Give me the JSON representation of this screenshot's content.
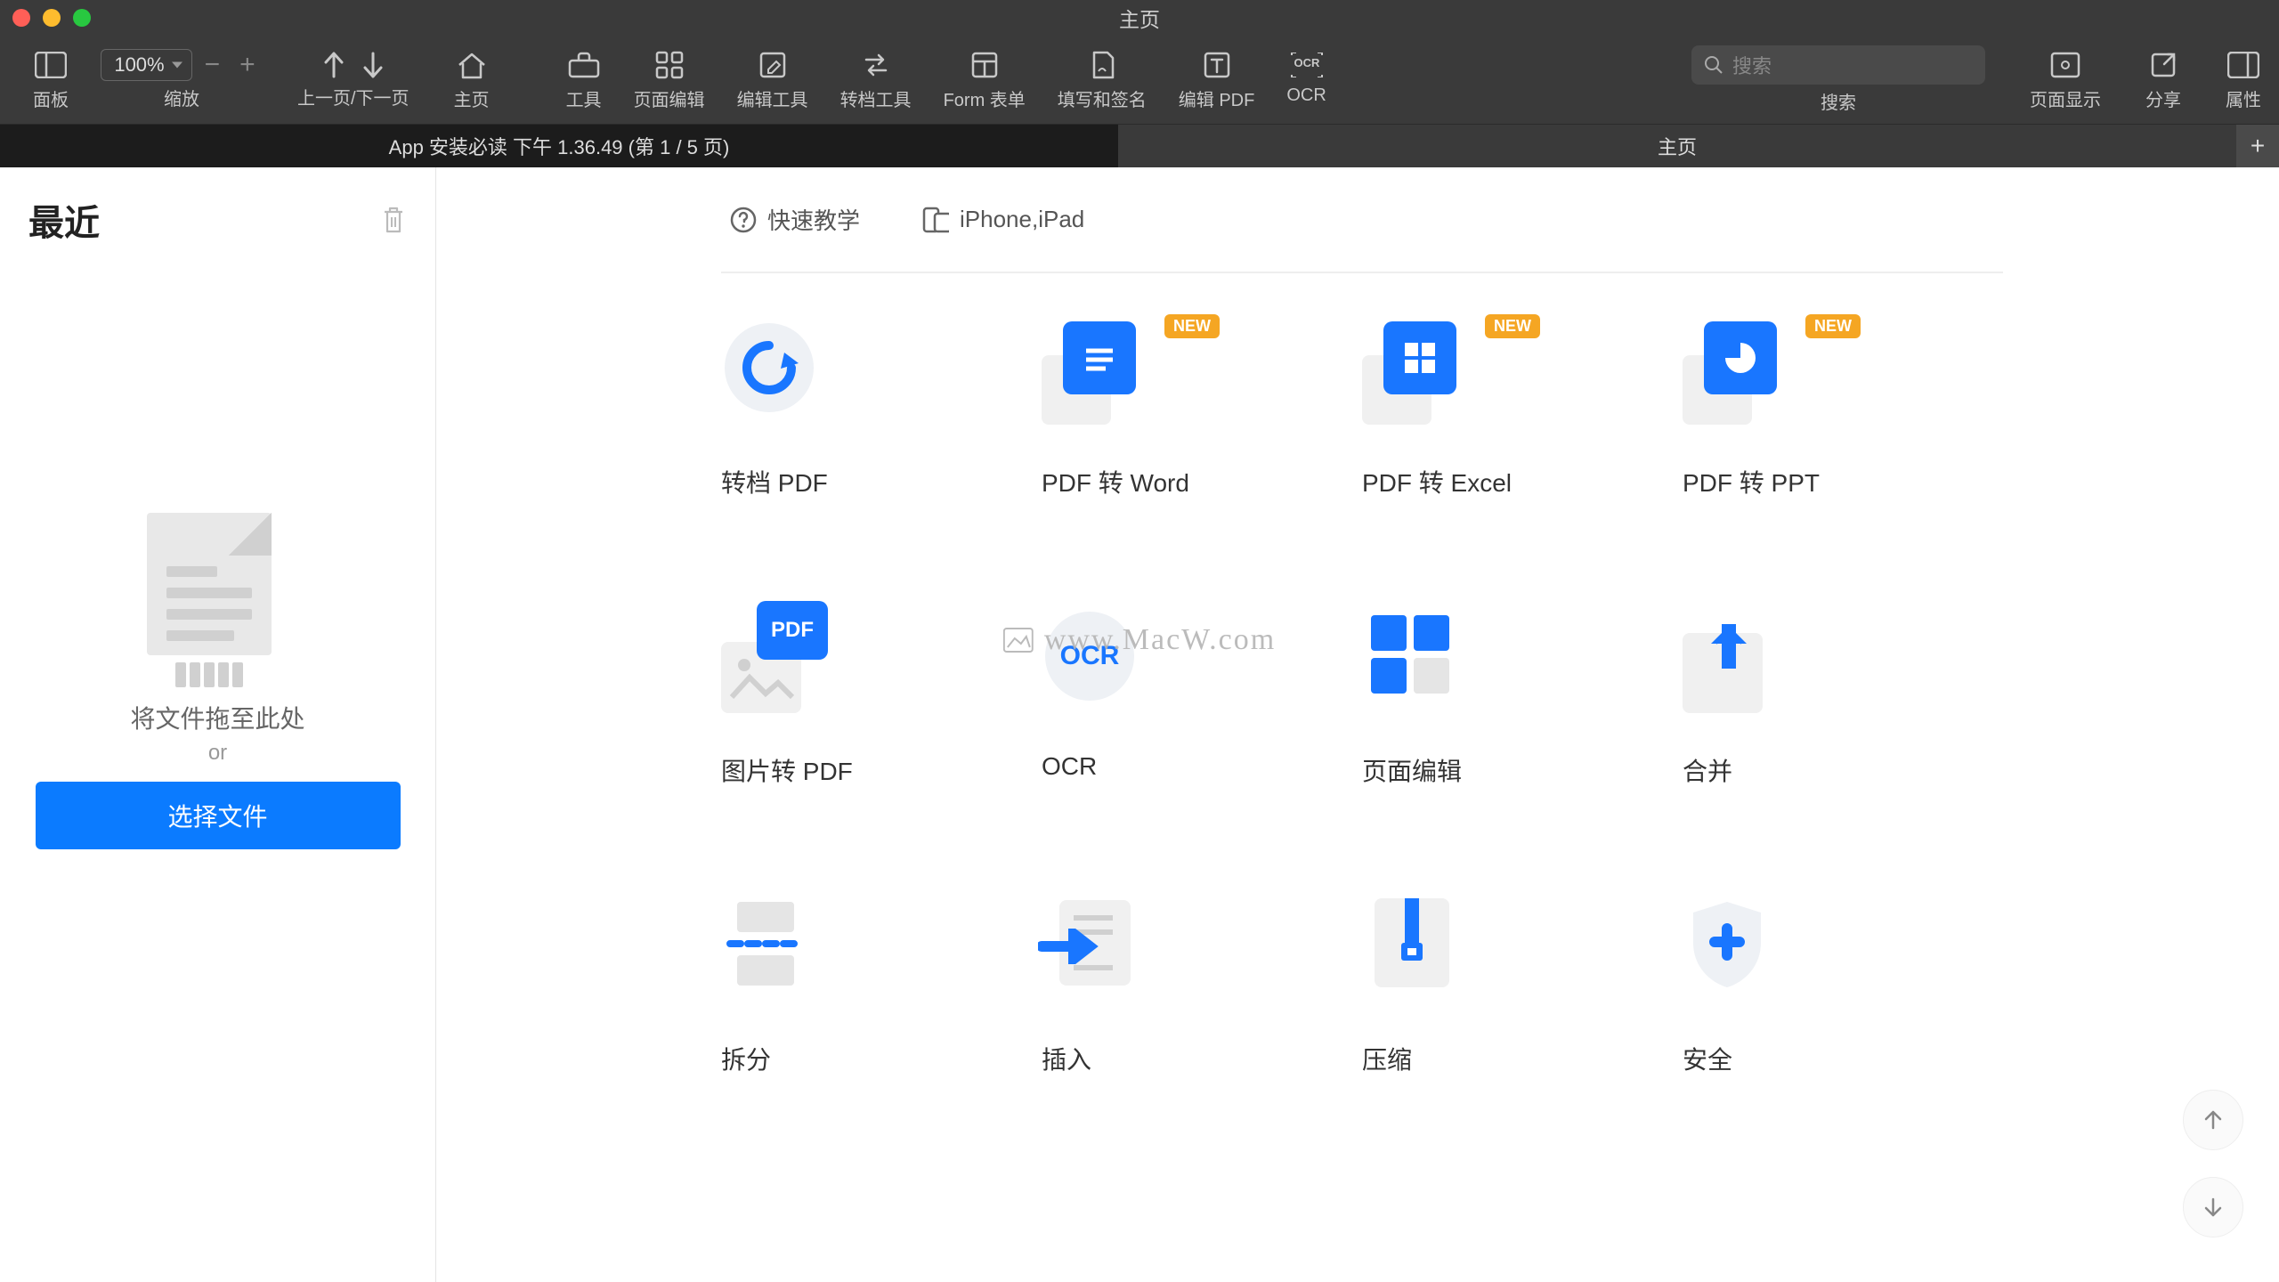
{
  "window": {
    "title": "主页"
  },
  "toolbar": {
    "panel": "面板",
    "zoom": "缩放",
    "zoom_value": "100%",
    "page_nav": "上一页/下一页",
    "home": "主页",
    "tools": "工具",
    "page_edit": "页面编辑",
    "edit_tools": "编辑工具",
    "convert_tools": "转档工具",
    "form": "Form 表单",
    "fill_sign": "填写和签名",
    "edit_pdf": "编辑 PDF",
    "ocr": "OCR",
    "search_label": "搜索",
    "search_placeholder": "搜索",
    "page_display": "页面显示",
    "share": "分享",
    "properties": "属性"
  },
  "tabs": {
    "tab1": "App 安装必读 下午 1.36.49 (第 1 / 5 页)",
    "tab2": "主页"
  },
  "sidebar": {
    "title": "最近",
    "drop_text": "将文件拖至此处",
    "or": "or",
    "select_btn": "选择文件"
  },
  "quicklinks": {
    "tutorial": "快速教学",
    "mobile": "iPhone,iPad"
  },
  "badge_new": "NEW",
  "tiles": {
    "r1c1": "转档 PDF",
    "r1c2": "PDF 转 Word",
    "r1c3": "PDF 转 Excel",
    "r1c4": "PDF 转 PPT",
    "r2c1": "图片转 PDF",
    "r2c2": "OCR",
    "r2c3": "页面编辑",
    "r2c4": "合并",
    "r3c1": "拆分",
    "r3c2": "插入",
    "r3c3": "压缩",
    "r3c4": "安全"
  },
  "watermark": "www.MacW.com"
}
